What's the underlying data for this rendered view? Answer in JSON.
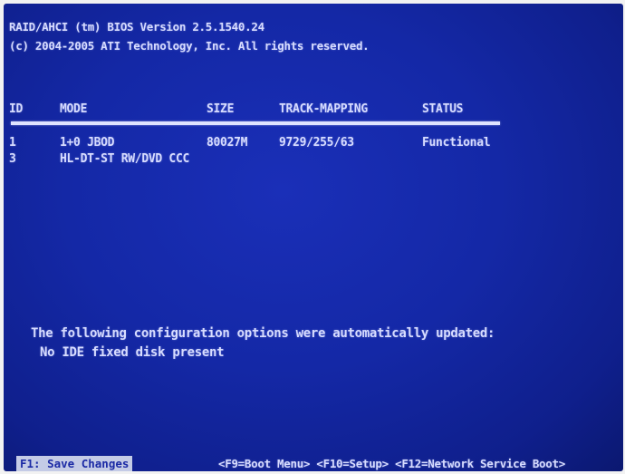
{
  "header": {
    "line1": "RAID/AHCI (tm) BIOS Version 2.5.1540.24",
    "line2": "(c) 2004-2005 ATI Technology, Inc. All rights reserved."
  },
  "table": {
    "columns": [
      "ID",
      "MODE",
      "SIZE",
      "TRACK-MAPPING",
      "STATUS"
    ],
    "rows": [
      {
        "id": "1",
        "mode": "1+0 JBOD",
        "size": "80027M",
        "track": "9729/255/63",
        "status": "Functional"
      },
      {
        "id": "3",
        "mode": "HL-DT-ST RW/DVD CCC",
        "size": "",
        "track": "",
        "status": ""
      }
    ]
  },
  "notice": {
    "line1": "The following configuration options were automatically updated:",
    "line2": "No IDE fixed disk present"
  },
  "footer": {
    "f1": "F1: Save Changes",
    "keys": "<F9=Boot Menu> <F10=Setup> <F12=Network Service Boot>"
  },
  "colors": {
    "screen_bg": "#1428a6",
    "text": "#d7dcff",
    "highlight_bg": "#c4cbe6"
  }
}
